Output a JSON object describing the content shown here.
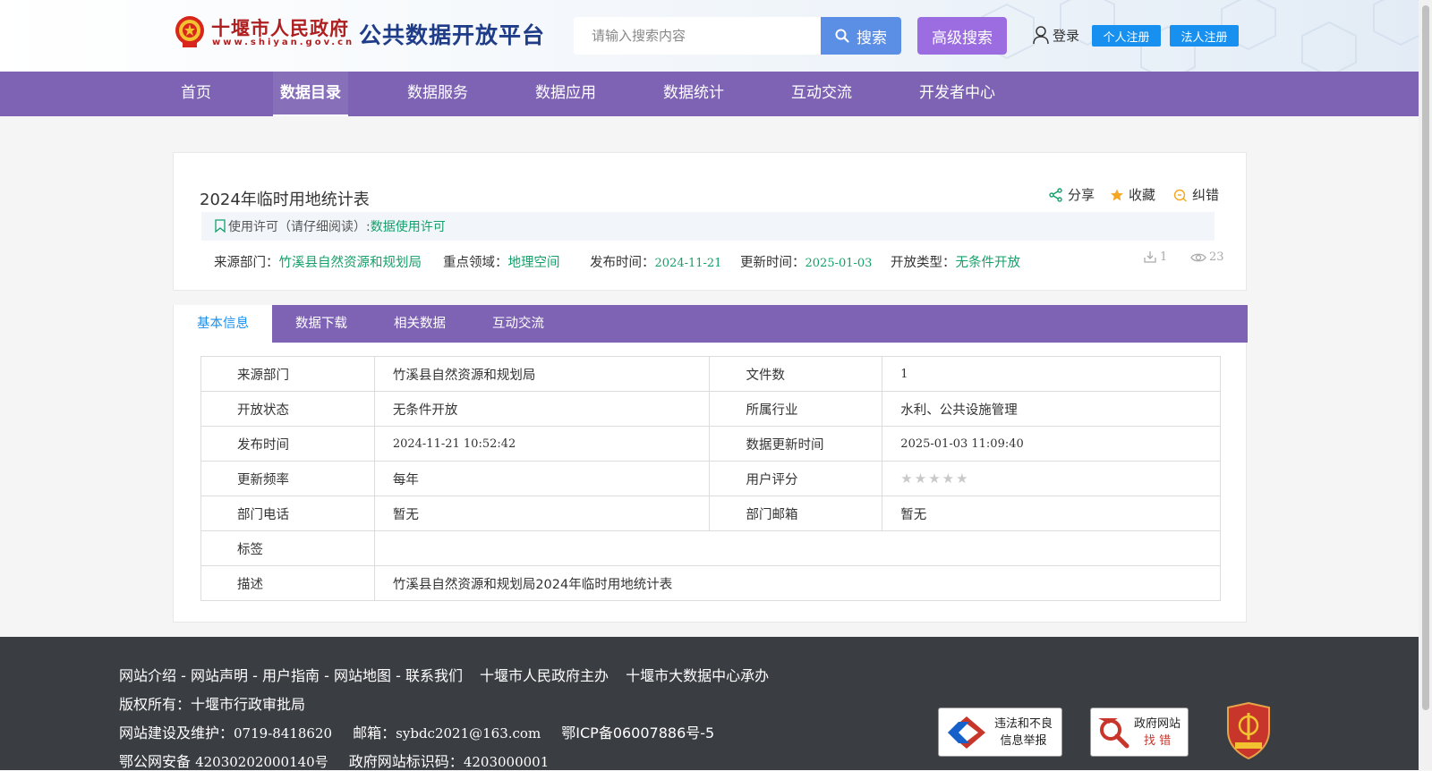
{
  "header": {
    "gov_name": "十堰市人民政府",
    "gov_url": "www.shiyan.gov.cn",
    "platform_title": "公共数据开放平台",
    "search_placeholder": "请输入搜索内容",
    "search_label": "搜索",
    "advanced_search_label": "高级搜索",
    "login_label": "登录",
    "personal_register_label": "个人注册",
    "legal_register_label": "法人注册"
  },
  "nav": {
    "items": [
      {
        "label": "首页"
      },
      {
        "label": "数据目录",
        "active": true
      },
      {
        "label": "数据服务"
      },
      {
        "label": "数据应用"
      },
      {
        "label": "数据统计"
      },
      {
        "label": "互动交流"
      },
      {
        "label": "开发者中心"
      }
    ]
  },
  "dataset": {
    "title": "2024年临时用地统计表",
    "actions": {
      "share": "分享",
      "favorite": "收藏",
      "correct": "纠错"
    },
    "license_prefix": "使用许可（请仔细阅读）:",
    "license_link": "数据使用许可",
    "meta": {
      "source_label": "来源部门：",
      "source_value": "竹溪县自然资源和规划局",
      "domain_label": "重点领域：",
      "domain_value": "地理空间",
      "publish_label": "发布时间：",
      "publish_value": "2024-11-21",
      "update_label": "更新时间：",
      "update_value": "2025-01-03",
      "open_label": "开放类型：",
      "open_value": "无条件开放"
    },
    "download_count": "1",
    "view_count": "23"
  },
  "tabs": [
    {
      "label": "基本信息",
      "active": true
    },
    {
      "label": "数据下载"
    },
    {
      "label": "相关数据"
    },
    {
      "label": "互动交流"
    }
  ],
  "info_table": {
    "rows": [
      {
        "l1": "来源部门",
        "v1": "竹溪县自然资源和规划局",
        "l2": "文件数",
        "v2": "1"
      },
      {
        "l1": "开放状态",
        "v1": "无条件开放",
        "l2": "所属行业",
        "v2": "水利、公共设施管理"
      },
      {
        "l1": "发布时间",
        "v1": "2024-11-21 10:52:42",
        "l2": "数据更新时间",
        "v2": "2025-01-03 11:09:40"
      },
      {
        "l1": "更新频率",
        "v1": "每年",
        "l2": "用户评分",
        "rating": 0
      },
      {
        "l1": "部门电话",
        "v1": "暂无",
        "l2": "部门邮箱",
        "v2": "暂无"
      }
    ],
    "tag_label": "标签",
    "tag_value": "",
    "desc_label": "描述",
    "desc_value": "竹溪县自然资源和规划局2024年临时用地统计表"
  },
  "footer": {
    "links": [
      "网站介绍",
      "网站声明",
      "用户指南",
      "网站地图",
      "联系我们"
    ],
    "sep": "-",
    "host": "十堰市人民政府主办",
    "undertaker": "十堰市大数据中心承办",
    "copyright_label": "版权所有：",
    "copyright_value": "十堰市行政审批局",
    "maint_label": "网站建设及维护：",
    "maint_phone": "0719-8418620",
    "email_label": "邮箱：",
    "email_value": "sybdc2021@163.com",
    "icp": "鄂ICP备06007886号-5",
    "police_label": "鄂公网安备 ",
    "police_value": "42030202000140号",
    "site_id_label": "政府网站标识码：",
    "site_id_value": "4203000001",
    "badge_report_l1": "违法和不良",
    "badge_report_l2": "信息举报",
    "badge_error_l1": "政府网站",
    "badge_error_l2": "找 错",
    "colors": {
      "red_badge": "#c8352b",
      "gov_blue": "#1560c9"
    }
  },
  "colors": {
    "nav_purple": "#7e63b5",
    "link_green": "#14a06a",
    "search_blue": "#5b8fe6",
    "adv_purple": "#9b6de0",
    "register_blue": "#1890f0"
  }
}
